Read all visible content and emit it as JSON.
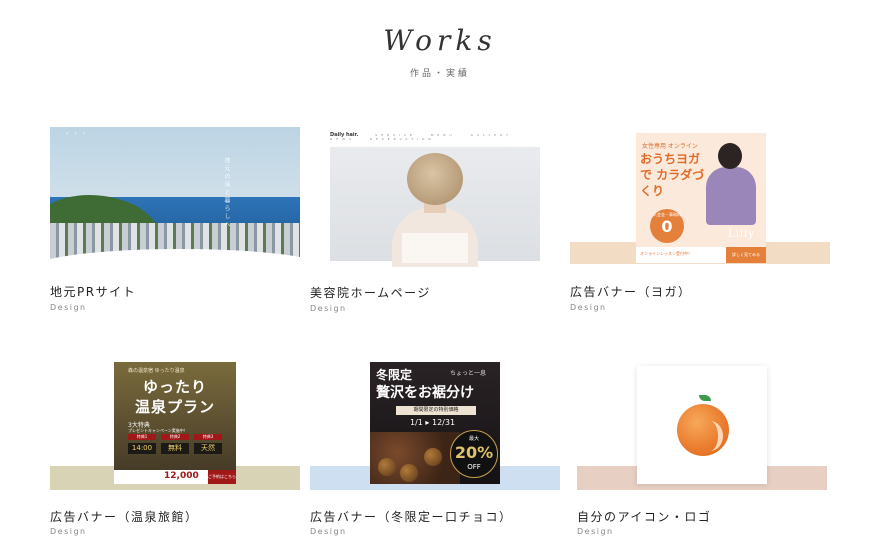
{
  "header": {
    "title": "Works",
    "subtitle": "作品・実績"
  },
  "works": [
    {
      "title": "地元PRサイト",
      "category": "Design",
      "thumb": {
        "nav": "•••",
        "vertical_text": "地元の海と暮らしへ"
      }
    },
    {
      "title": "美容院ホームページ",
      "category": "Design",
      "thumb": {
        "logo": "Daily hair.",
        "nav": "ABOUT · SERVICE · MENU · GALLERY · NEWS · RESERVATION"
      }
    },
    {
      "title": "広告バナー（ヨガ）",
      "category": "Design",
      "stripe_color": "#f3dcc4",
      "banner": {
        "line1": "女性専用 オンライン",
        "line2": "おうちヨガで カラダづくり",
        "circle_top": "入会金・事務料",
        "circle_value": "0",
        "brand": "Lilly",
        "footer": "オンラインレッスン受付中！",
        "button": "詳しく見てみる"
      }
    },
    {
      "title": "広告バナー（温泉旅館）",
      "category": "Design",
      "stripe_color": "#d9d3b6",
      "banner": {
        "line0": "森の温泉宿 ゆったり温泉",
        "line1": "ゆったり",
        "line2": "温泉プラン",
        "line3": "3大特典",
        "line4": "プレゼントキャンペーン実施中！",
        "tags": [
          "特典1",
          "特典2",
          "特典3"
        ],
        "boxes": [
          "14:00",
          "無料",
          "天然"
        ],
        "price": "12,000",
        "button": "ご予約はこちら"
      }
    },
    {
      "title": "広告バナー（冬限定ー口チョコ）",
      "category": "Design",
      "stripe_color": "#cddff0",
      "banner": {
        "line1": "冬限定",
        "line0": "ちょっと一息",
        "line2": "贅沢をお裾分け",
        "ribbon": "期間限定の特別価格",
        "date": "1/1 ▸ 12/31",
        "seal_top": "最大",
        "seal_value": "20%",
        "seal_bottom": "OFF"
      }
    },
    {
      "title": "自分のアイコン・ロゴ",
      "category": "Design",
      "stripe_color": "#e8cfc3"
    }
  ]
}
